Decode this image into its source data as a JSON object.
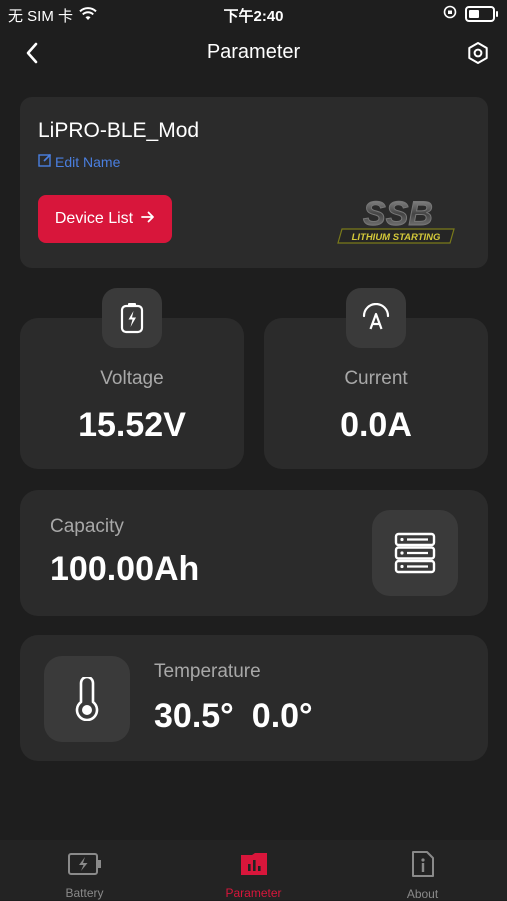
{
  "status_bar": {
    "carrier": "无 SIM 卡",
    "time": "下午2:40",
    "battery_level": 0.4
  },
  "nav": {
    "title": "Parameter",
    "back_icon": "chevron-left-icon",
    "settings_icon": "gear-icon"
  },
  "device": {
    "name": "LiPRO-BLE_Mod",
    "edit_label": "Edit Name",
    "device_list_label": "Device List",
    "brand_logo_text": "SSB",
    "brand_tagline": "LITHIUM STARTING"
  },
  "voltage": {
    "label": "Voltage",
    "value": "15.52V",
    "icon": "battery-bolt-icon"
  },
  "current": {
    "label": "Current",
    "value": "0.0A",
    "icon": "ampere-icon"
  },
  "capacity": {
    "label": "Capacity",
    "value": "100.00Ah",
    "icon": "server-stack-icon"
  },
  "temperature": {
    "label": "Temperature",
    "value1": "30.5°",
    "value2": "0.0°",
    "icon": "thermometer-icon"
  },
  "tabs": [
    {
      "label": "Battery",
      "icon": "battery-charging-icon",
      "active": false
    },
    {
      "label": "Parameter",
      "icon": "bar-chart-icon",
      "active": true
    },
    {
      "label": "About",
      "icon": "info-icon",
      "active": false
    }
  ],
  "colors": {
    "background": "#1e1e1e",
    "card": "#2b2b2b",
    "accent": "#d8163b",
    "link": "#4a7fe0"
  }
}
